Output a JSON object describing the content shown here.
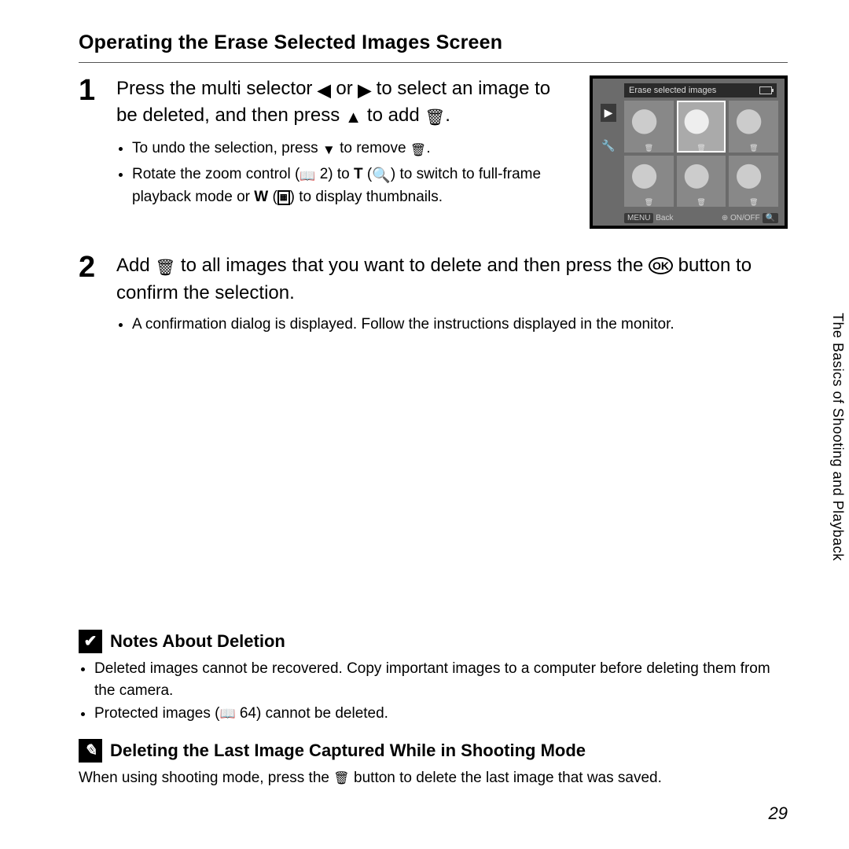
{
  "title": "Operating the Erase Selected Images Screen",
  "step1": {
    "num": "1",
    "lead_a": "Press the multi selector ",
    "lead_b": " or ",
    "lead_c": " to select an image to be deleted, and then press ",
    "lead_d": " to add ",
    "lead_e": ".",
    "sub1_a": "To undo the selection, press ",
    "sub1_b": " to remove ",
    "sub1_c": ".",
    "sub2_a": "Rotate the zoom control (",
    "sub2_ref": " 2",
    "sub2_b": ") to ",
    "sub2_T": "T",
    "sub2_c": " (",
    "sub2_d": ") to switch to full-frame playback mode or ",
    "sub2_W": "W",
    "sub2_e": " (",
    "sub2_f": ") to display thumbnails."
  },
  "step2": {
    "num": "2",
    "lead_a": "Add ",
    "lead_b": " to all images that you want to delete and then press the ",
    "lead_c": " button to confirm the selection.",
    "sub1": "A confirmation dialog is displayed. Follow the instructions displayed in the monitor."
  },
  "lcd": {
    "title": "Erase selected images",
    "back_tag": "MENU",
    "back": "Back",
    "onoff": "ON/OFF"
  },
  "side_tab": "The Basics of Shooting and Playback",
  "notes": {
    "heading": "Notes About Deletion",
    "n1": "Deleted images cannot be recovered. Copy important images to a computer before deleting them from the camera.",
    "n2_a": "Protected images (",
    "n2_ref": " 64",
    "n2_b": ") cannot be deleted."
  },
  "lastimg": {
    "heading": "Deleting the Last Image Captured While in Shooting Mode",
    "body_a": "When using shooting mode, press the ",
    "body_b": " button to delete the last image that was saved."
  },
  "page_number": "29",
  "glyphs": {
    "left": "◀",
    "right": "▶",
    "up": "▲",
    "down": "▼",
    "trash": "🗑",
    "book": "▭",
    "mag": "🔍",
    "thumbs": "▦",
    "ok": "OK",
    "check": "✔",
    "pencil": "✎",
    "play": "▶",
    "wrench": "🔧"
  }
}
